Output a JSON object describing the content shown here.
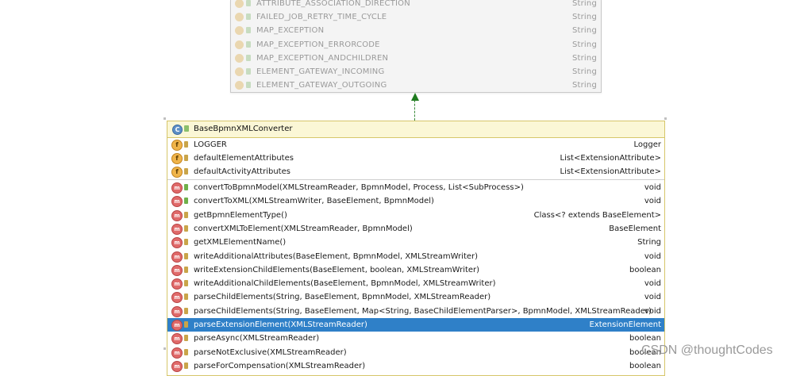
{
  "interface_box": {
    "rows": [
      {
        "name": "ATTRIBUTE_ASSOCIATION_DIRECTION",
        "type": "String"
      },
      {
        "name": "FAILED_JOB_RETRY_TIME_CYCLE",
        "type": "String"
      },
      {
        "name": "MAP_EXCEPTION",
        "type": "String"
      },
      {
        "name": "MAP_EXCEPTION_ERRORCODE",
        "type": "String"
      },
      {
        "name": "MAP_EXCEPTION_ANDCHILDREN",
        "type": "String"
      },
      {
        "name": "ELEMENT_GATEWAY_INCOMING",
        "type": "String"
      },
      {
        "name": "ELEMENT_GATEWAY_OUTGOING",
        "type": "String"
      }
    ]
  },
  "class_box": {
    "title": "BaseBpmnXMLConverter",
    "class_icon_letter": "C",
    "fields": [
      {
        "name": "LOGGER",
        "type": "Logger",
        "access": "prot"
      },
      {
        "name": "defaultElementAttributes",
        "type": "List<ExtensionAttribute>",
        "access": "prot"
      },
      {
        "name": "defaultActivityAttributes",
        "type": "List<ExtensionAttribute>",
        "access": "prot"
      }
    ],
    "methods": [
      {
        "name": "convertToBpmnModel(XMLStreamReader, BpmnModel, Process, List<SubProcess>)",
        "type": "void",
        "access": "pub",
        "selected": false
      },
      {
        "name": "convertToXML(XMLStreamWriter, BaseElement, BpmnModel)",
        "type": "void",
        "access": "pub",
        "selected": false
      },
      {
        "name": "getBpmnElementType()",
        "type": "Class<? extends BaseElement>",
        "access": "prot",
        "selected": false
      },
      {
        "name": "convertXMLToElement(XMLStreamReader, BpmnModel)",
        "type": "BaseElement",
        "access": "prot",
        "selected": false
      },
      {
        "name": "getXMLElementName()",
        "type": "String",
        "access": "prot",
        "selected": false
      },
      {
        "name": "writeAdditionalAttributes(BaseElement, BpmnModel, XMLStreamWriter)",
        "type": "void",
        "access": "prot",
        "selected": false
      },
      {
        "name": "writeExtensionChildElements(BaseElement, boolean, XMLStreamWriter)",
        "type": "boolean",
        "access": "prot",
        "selected": false
      },
      {
        "name": "writeAdditionalChildElements(BaseElement, BpmnModel, XMLStreamWriter)",
        "type": "void",
        "access": "prot",
        "selected": false
      },
      {
        "name": "parseChildElements(String, BaseElement, BpmnModel, XMLStreamReader)",
        "type": "void",
        "access": "prot",
        "selected": false
      },
      {
        "name": "parseChildElements(String, BaseElement, Map<String, BaseChildElementParser>, BpmnModel, XMLStreamReader)",
        "type": "void",
        "access": "prot",
        "selected": false
      },
      {
        "name": "parseExtensionElement(XMLStreamReader)",
        "type": "ExtensionElement",
        "access": "prot",
        "selected": true
      },
      {
        "name": "parseAsync(XMLStreamReader)",
        "type": "boolean",
        "access": "prot",
        "selected": false
      },
      {
        "name": "parseNotExclusive(XMLStreamReader)",
        "type": "boolean",
        "access": "prot",
        "selected": false
      },
      {
        "name": "parseForCompensation(XMLStreamReader)",
        "type": "boolean",
        "access": "prot",
        "selected": false
      }
    ]
  },
  "watermark": "CSDN @thoughtCodes",
  "colors": {
    "selection": "#2f80c8",
    "header_bg": "#fbf7d6",
    "header_border": "#d6c66a",
    "arrow": "#1e7a1e"
  }
}
